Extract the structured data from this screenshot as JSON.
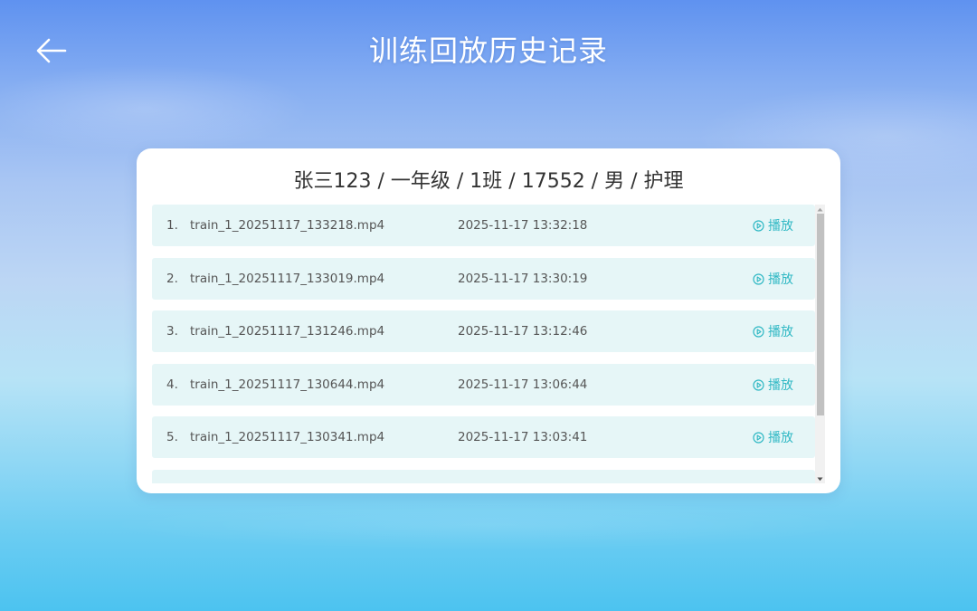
{
  "page": {
    "title": "训练回放历史记录",
    "accent_color": "#2fb8c4",
    "row_color": "#e6f6f7"
  },
  "header": {
    "back_icon": "arrow-left-icon"
  },
  "card": {
    "student_info": "张三123 / 一年级 / 1班 / 17552 / 男 / 护理"
  },
  "records": [
    {
      "index": "1.",
      "file": "train_1_20251117_133218.mp4",
      "time": "2025-11-17 13:32:18",
      "action": "播放"
    },
    {
      "index": "2.",
      "file": "train_1_20251117_133019.mp4",
      "time": "2025-11-17 13:30:19",
      "action": "播放"
    },
    {
      "index": "3.",
      "file": "train_1_20251117_131246.mp4",
      "time": "2025-11-17 13:12:46",
      "action": "播放"
    },
    {
      "index": "4.",
      "file": "train_1_20251117_130644.mp4",
      "time": "2025-11-17 13:06:44",
      "action": "播放"
    },
    {
      "index": "5.",
      "file": "train_1_20251117_130341.mp4",
      "time": "2025-11-17 13:03:41",
      "action": "播放"
    },
    {
      "index": "",
      "file": "",
      "time": "",
      "action": ""
    }
  ]
}
